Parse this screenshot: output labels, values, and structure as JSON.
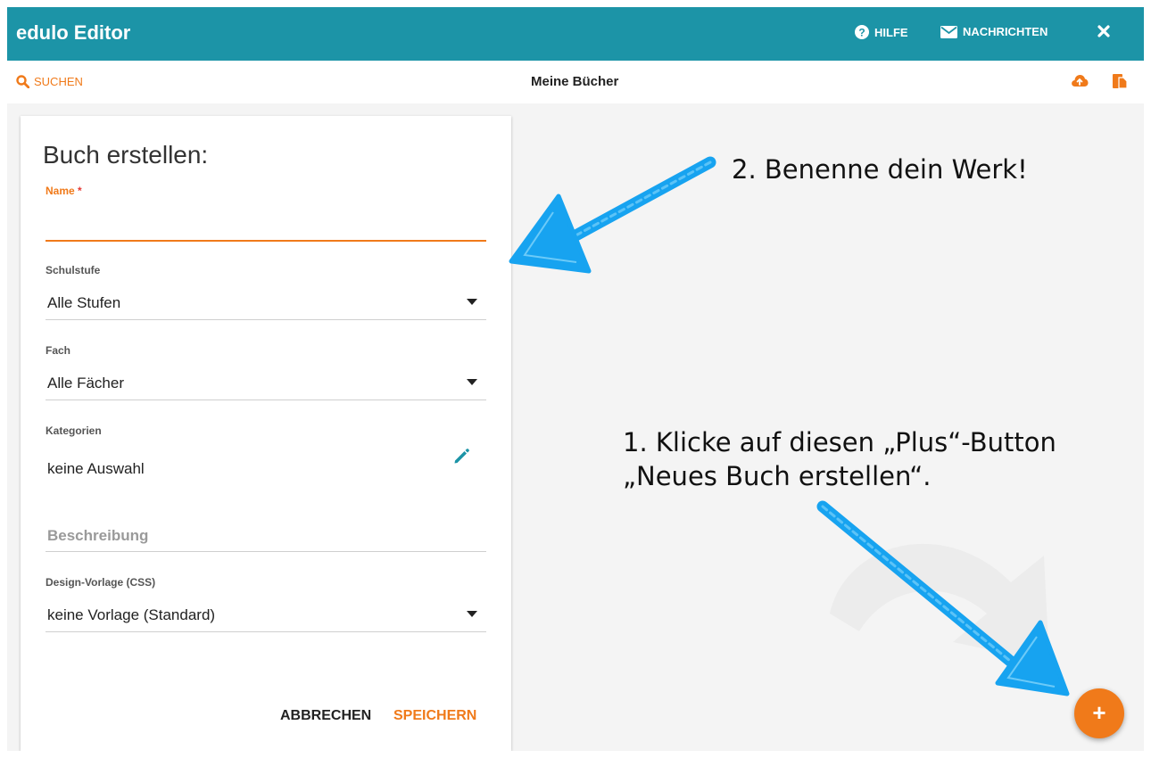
{
  "header": {
    "app_title": "edulo Editor",
    "help_label": "HILFE",
    "messages_label": "NACHRICHTEN"
  },
  "subheader": {
    "search_label": "SUCHEN",
    "page_title": "Meine Bücher"
  },
  "form": {
    "title": "Buch erstellen:",
    "name_label": "Name",
    "required_mark": "*",
    "name_value": "",
    "schulstufe_label": "Schulstufe",
    "schulstufe_value": "Alle Stufen",
    "fach_label": "Fach",
    "fach_value": "Alle Fächer",
    "kategorien_label": "Kategorien",
    "kategorien_value": "keine Auswahl",
    "beschreibung_placeholder": "Beschreibung",
    "design_label": "Design-Vorlage (CSS)",
    "design_value": "keine Vorlage (Standard)",
    "cancel_label": "ABBRECHEN",
    "save_label": "SPEICHERN"
  },
  "annotations": {
    "step2": "2. Benenne dein Werk!",
    "step1_line1": "1. Klicke auf diesen „Plus“-Button",
    "step1_line2": "„Neues Buch erstellen“."
  },
  "fab": {
    "label": "+"
  },
  "colors": {
    "header_bg": "#1c94a7",
    "accent": "#f07a1a",
    "arrow": "#17a3f0",
    "background": "#f4f4f4"
  },
  "icons": [
    "question-circle-icon",
    "envelope-icon",
    "close-icon",
    "search-icon",
    "cloud-upload-icon",
    "import-icon",
    "pencil-icon",
    "chevron-down-icon",
    "plus-icon"
  ]
}
